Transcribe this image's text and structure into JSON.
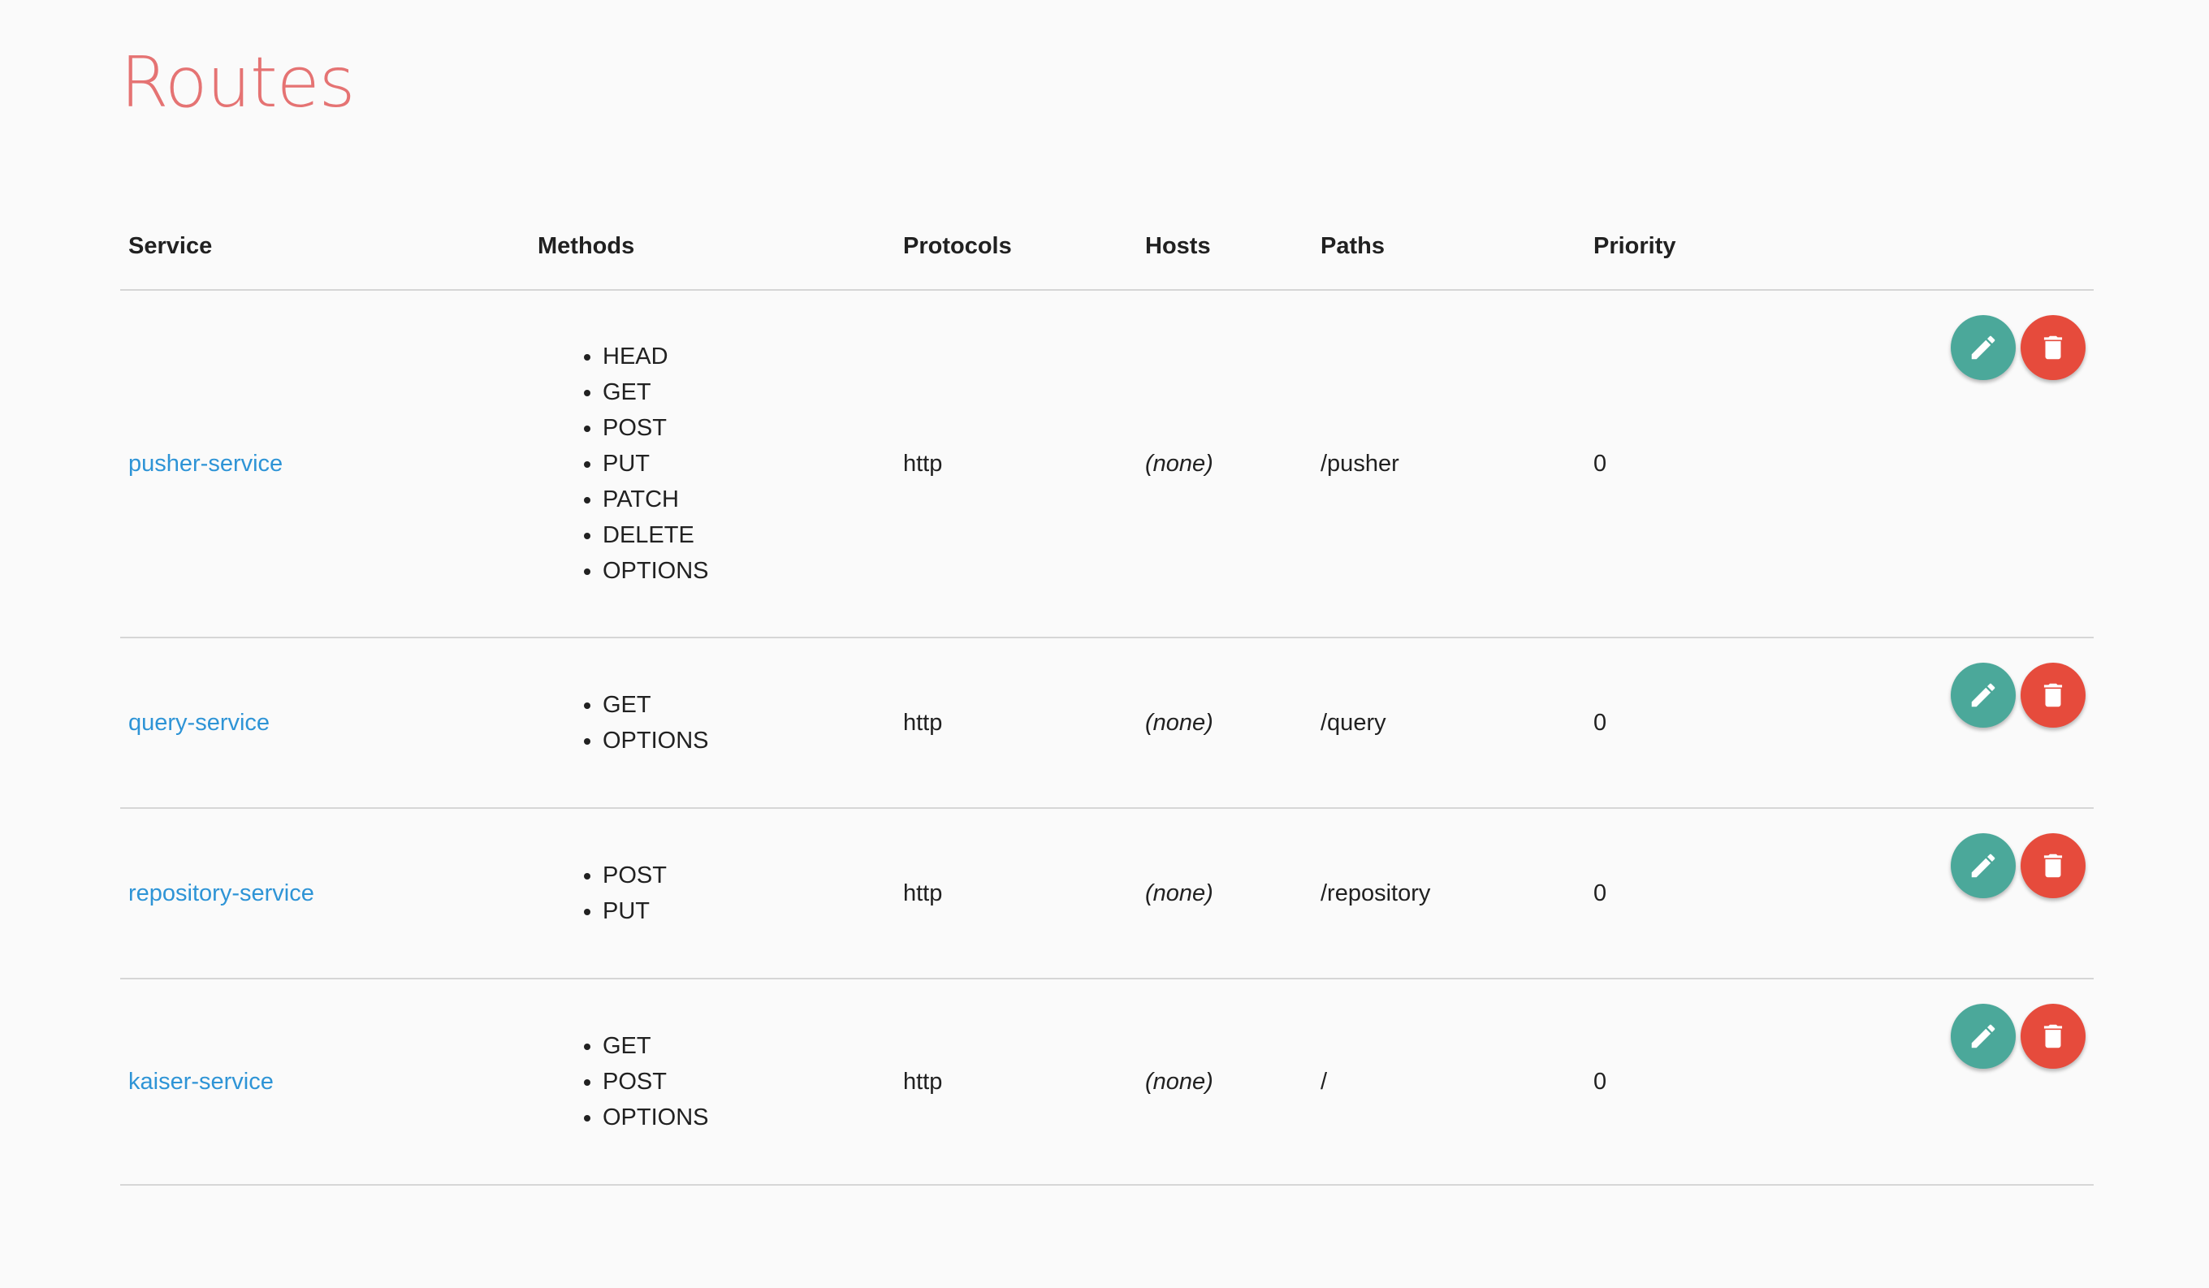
{
  "page": {
    "title": "Routes"
  },
  "table": {
    "headers": {
      "service": "Service",
      "methods": "Methods",
      "protocols": "Protocols",
      "hosts": "Hosts",
      "paths": "Paths",
      "priority": "Priority"
    },
    "rows": [
      {
        "service": "pusher-service",
        "methods": [
          "HEAD",
          "GET",
          "POST",
          "PUT",
          "PATCH",
          "DELETE",
          "OPTIONS"
        ],
        "protocols": "http",
        "hosts": "(none)",
        "paths": "/pusher",
        "priority": "0"
      },
      {
        "service": "query-service",
        "methods": [
          "GET",
          "OPTIONS"
        ],
        "protocols": "http",
        "hosts": "(none)",
        "paths": "/query",
        "priority": "0"
      },
      {
        "service": "repository-service",
        "methods": [
          "POST",
          "PUT"
        ],
        "protocols": "http",
        "hosts": "(none)",
        "paths": "/repository",
        "priority": "0"
      },
      {
        "service": "kaiser-service",
        "methods": [
          "GET",
          "POST",
          "OPTIONS"
        ],
        "protocols": "http",
        "hosts": "(none)",
        "paths": "/",
        "priority": "0"
      }
    ]
  },
  "icons": {
    "edit": "pencil-icon",
    "delete": "trash-icon"
  },
  "colors": {
    "title": "#e57373",
    "link": "#2e94d6",
    "edit_button": "#4ba89a",
    "delete_button": "#e64b3c"
  }
}
